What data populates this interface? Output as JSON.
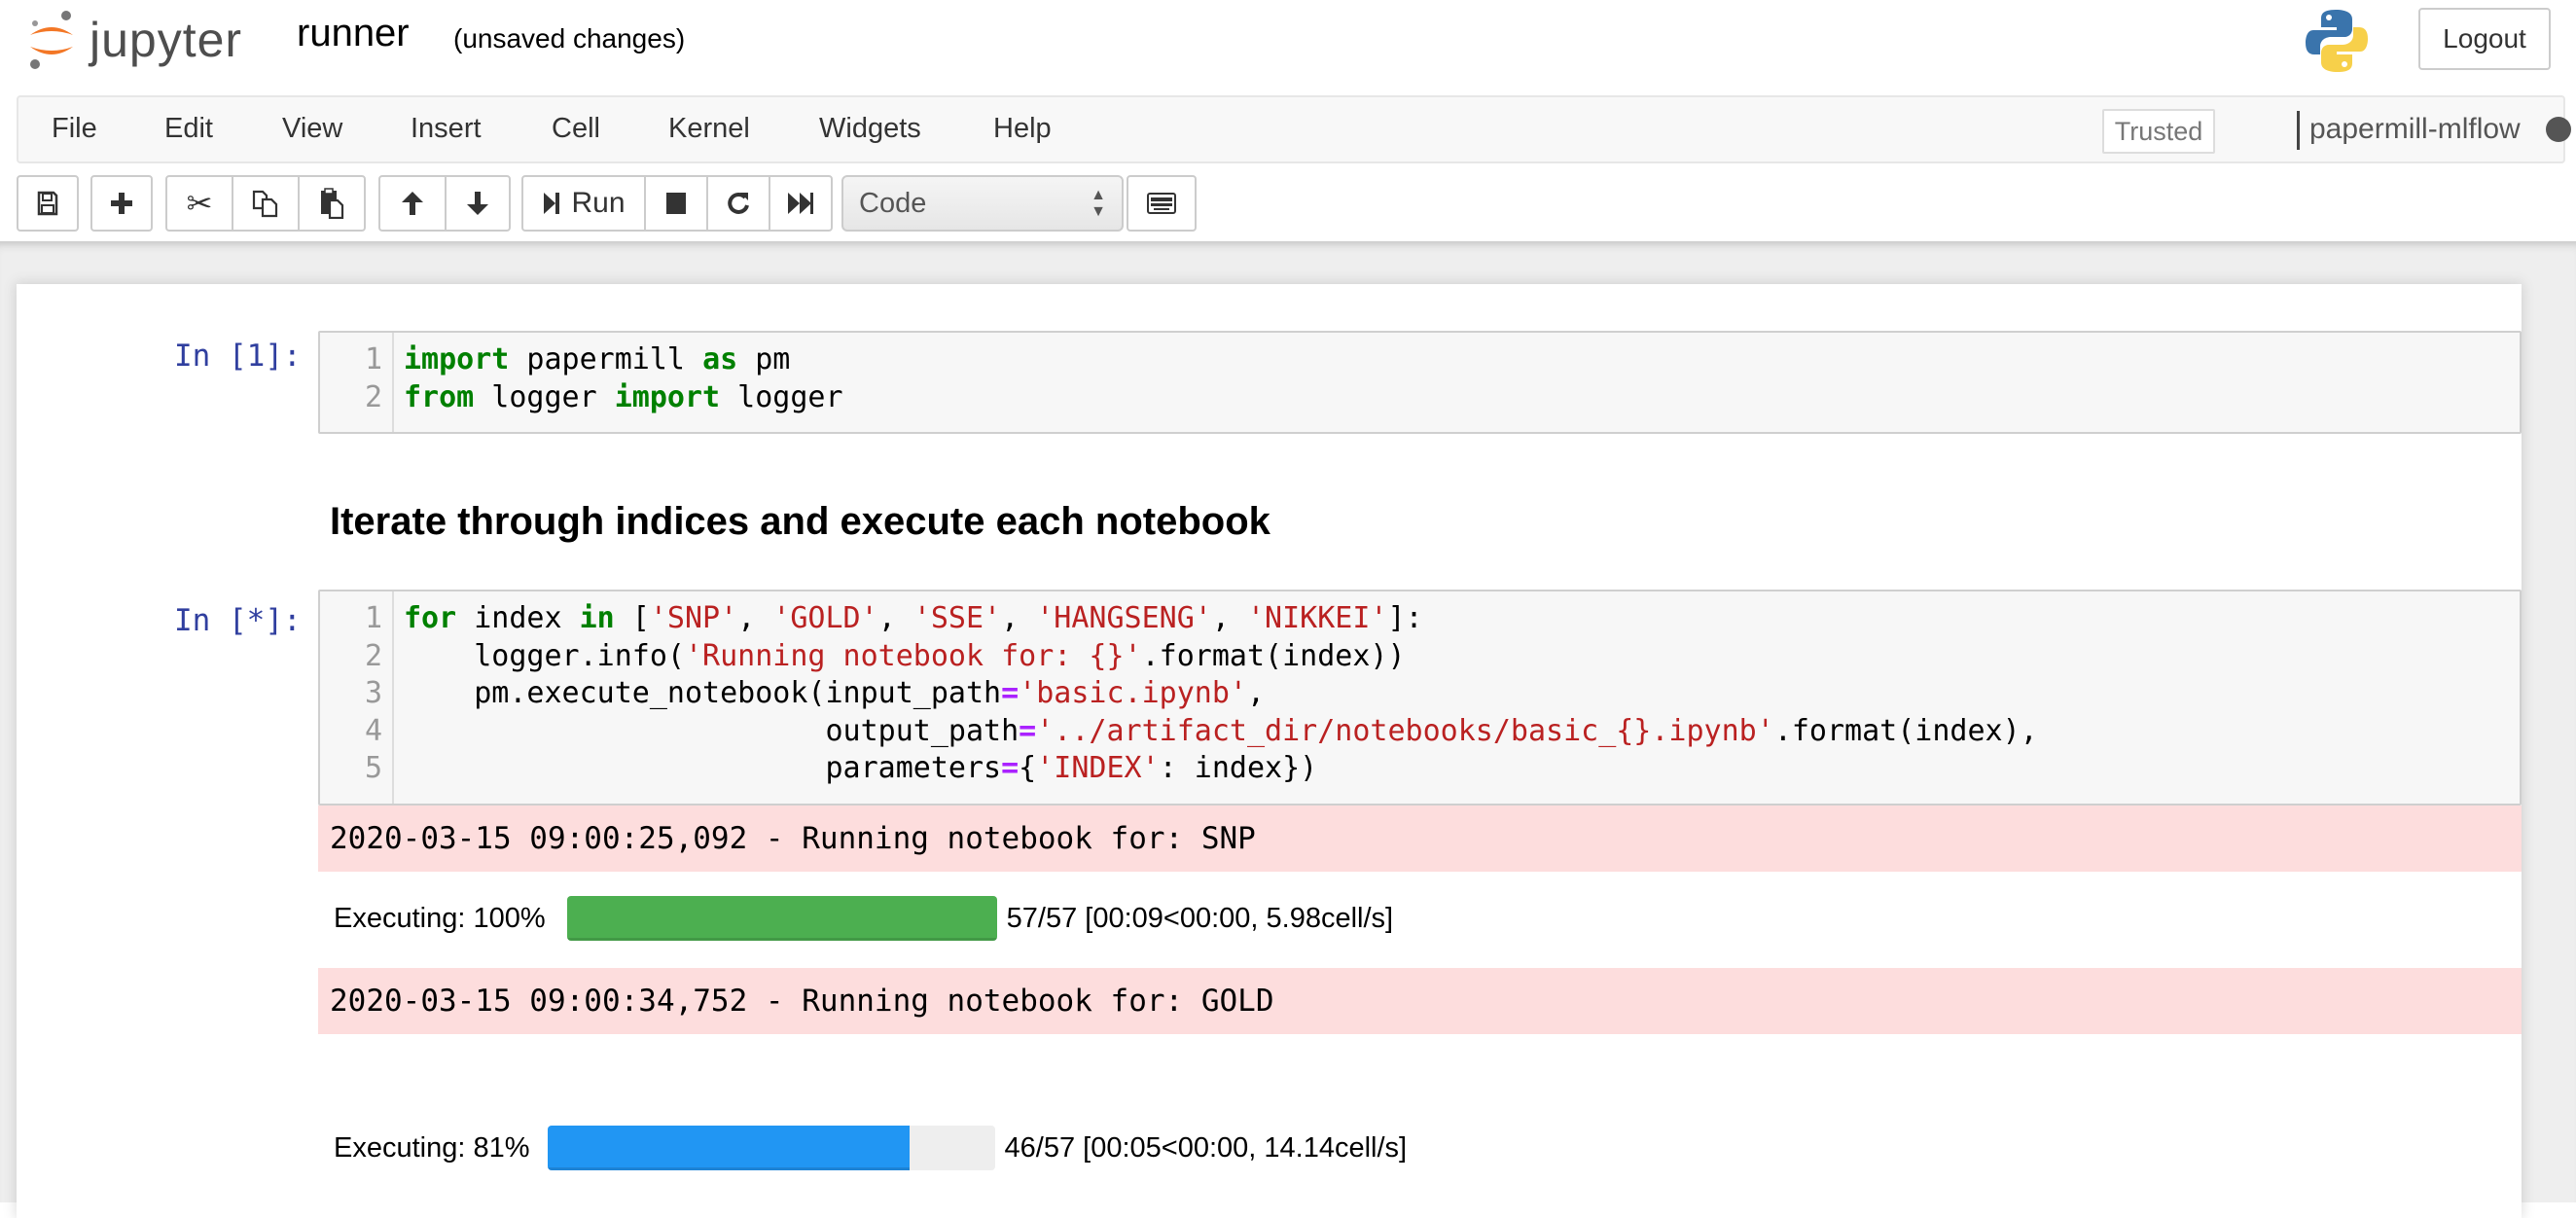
{
  "header": {
    "logo_text": "jupyter",
    "notebook_name": "runner",
    "save_status": "(unsaved changes)",
    "logout_label": "Logout",
    "logo_colors": {
      "orange": "#f37726",
      "gray": "#767677"
    }
  },
  "menubar": {
    "items": [
      {
        "label": "File"
      },
      {
        "label": "Edit"
      },
      {
        "label": "View"
      },
      {
        "label": "Insert"
      },
      {
        "label": "Cell"
      },
      {
        "label": "Kernel"
      },
      {
        "label": "Widgets"
      },
      {
        "label": "Help"
      }
    ],
    "trusted_label": "Trusted",
    "kernel_name": "papermill-mlflow",
    "kernel_status": "busy"
  },
  "toolbar": {
    "buttons": [
      {
        "icon": "save-icon",
        "tooltip": "save"
      },
      {
        "icon": "plus-icon",
        "tooltip": "insert cell below"
      },
      {
        "icon": "scissors-icon",
        "tooltip": "cut"
      },
      {
        "icon": "copy-icon",
        "tooltip": "copy"
      },
      {
        "icon": "paste-icon",
        "tooltip": "paste"
      },
      {
        "icon": "arrow-up-icon",
        "tooltip": "move up"
      },
      {
        "icon": "arrow-down-icon",
        "tooltip": "move down"
      },
      {
        "icon": "step-forward-icon",
        "tooltip": "run"
      },
      {
        "icon": "stop-icon",
        "tooltip": "interrupt"
      },
      {
        "icon": "restart-icon",
        "tooltip": "restart"
      },
      {
        "icon": "fast-forward-icon",
        "tooltip": "restart and run all"
      },
      {
        "icon": "keyboard-icon",
        "tooltip": "command palette"
      }
    ],
    "run_label": "Run",
    "cell_type": "Code"
  },
  "cells": [
    {
      "type": "code",
      "prompt": "In [1]:",
      "lines": [
        [
          {
            "t": "kw",
            "v": "import"
          },
          {
            "t": "",
            "v": " papermill "
          },
          {
            "t": "kw",
            "v": "as"
          },
          {
            "t": "",
            "v": " pm"
          }
        ],
        [
          {
            "t": "kw",
            "v": "from"
          },
          {
            "t": "",
            "v": " logger "
          },
          {
            "t": "kw",
            "v": "import"
          },
          {
            "t": "",
            "v": " logger"
          }
        ]
      ]
    },
    {
      "type": "markdown",
      "heading": "Iterate through indices and execute each notebook"
    },
    {
      "type": "code",
      "prompt": "In [*]:",
      "lines": [
        [
          {
            "t": "kw",
            "v": "for"
          },
          {
            "t": "",
            "v": " index "
          },
          {
            "t": "kw",
            "v": "in"
          },
          {
            "t": "",
            "v": " ["
          },
          {
            "t": "st",
            "v": "'SNP'"
          },
          {
            "t": "",
            "v": ", "
          },
          {
            "t": "st",
            "v": "'GOLD'"
          },
          {
            "t": "",
            "v": ", "
          },
          {
            "t": "st",
            "v": "'SSE'"
          },
          {
            "t": "",
            "v": ", "
          },
          {
            "t": "st",
            "v": "'HANGSENG'"
          },
          {
            "t": "",
            "v": ", "
          },
          {
            "t": "st",
            "v": "'NIKKEI'"
          },
          {
            "t": "",
            "v": "]:"
          }
        ],
        [
          {
            "t": "",
            "v": "    logger.info("
          },
          {
            "t": "st",
            "v": "'Running notebook for: {}'"
          },
          {
            "t": "",
            "v": ".format(index))"
          }
        ],
        [
          {
            "t": "",
            "v": "    pm.execute_notebook(input_path"
          },
          {
            "t": "op",
            "v": "="
          },
          {
            "t": "st",
            "v": "'basic.ipynb'"
          },
          {
            "t": "",
            "v": ","
          }
        ],
        [
          {
            "t": "",
            "v": "                        output_path"
          },
          {
            "t": "op",
            "v": "="
          },
          {
            "t": "st",
            "v": "'../artifact_dir/notebooks/basic_{}.ipynb'"
          },
          {
            "t": "",
            "v": ".format(index),"
          }
        ],
        [
          {
            "t": "",
            "v": "                        parameters"
          },
          {
            "t": "op",
            "v": "="
          },
          {
            "t": "",
            "v": "{"
          },
          {
            "t": "st",
            "v": "'INDEX'"
          },
          {
            "t": "",
            "v": ": index})"
          }
        ]
      ],
      "outputs": [
        {
          "type": "stderr",
          "text": "2020-03-15 09:00:25,092 - Running notebook for: SNP"
        },
        {
          "type": "progress",
          "label": "Executing: 100%",
          "fraction": 1.0,
          "color": "#4caf50",
          "stats": "57/57 [00:09<00:00, 5.98cell/s]"
        },
        {
          "type": "stderr",
          "text": "2020-03-15 09:00:34,752 - Running notebook for: GOLD"
        },
        {
          "type": "progress",
          "label": "Executing: 81%",
          "fraction": 0.81,
          "color": "#2196f3",
          "stats": "46/57 [00:05<00:00, 14.14cell/s]"
        }
      ]
    }
  ]
}
